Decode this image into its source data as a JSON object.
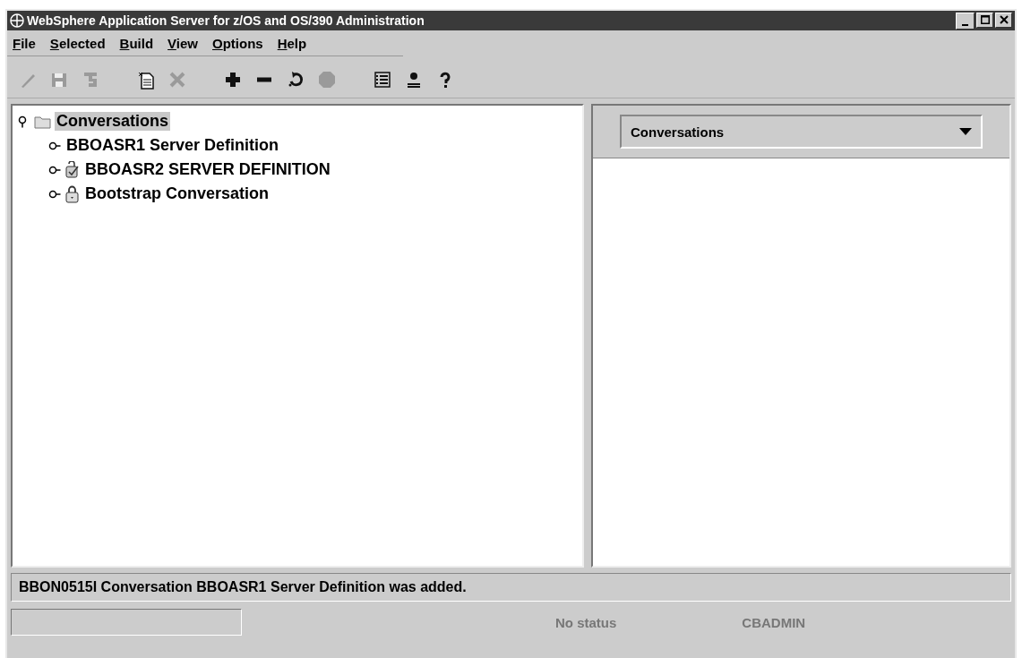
{
  "window": {
    "title": "WebSphere Application Server for z/OS and OS/390 Administration"
  },
  "menu": [
    {
      "label": "File",
      "selected": false
    },
    {
      "label": "Selected",
      "selected": false
    },
    {
      "label": "Build",
      "selected": false
    },
    {
      "label": "View",
      "selected": false
    },
    {
      "label": "Options",
      "selected": false
    },
    {
      "label": "Help",
      "selected": false
    }
  ],
  "toolbar": [
    {
      "kind": "pencil",
      "disabled": true
    },
    {
      "kind": "save",
      "disabled": true
    },
    {
      "kind": "undo",
      "disabled": true
    },
    {
      "kind": "gap"
    },
    {
      "kind": "new",
      "disabled": false
    },
    {
      "kind": "delete",
      "disabled": true
    },
    {
      "kind": "gap"
    },
    {
      "kind": "plus",
      "disabled": false
    },
    {
      "kind": "minus",
      "disabled": false
    },
    {
      "kind": "refresh",
      "disabled": false
    },
    {
      "kind": "stop",
      "disabled": true
    },
    {
      "kind": "gap"
    },
    {
      "kind": "list",
      "disabled": false
    },
    {
      "kind": "person",
      "disabled": false
    },
    {
      "kind": "help",
      "disabled": false
    }
  ],
  "tree": [
    {
      "label": "Conversations",
      "kind": "folder",
      "expanded": true,
      "selected": true,
      "children": [
        {
          "label": "BBOASR1 Server Definition",
          "kind": "plain",
          "expanded": false,
          "selected": false
        },
        {
          "label": "BBOASR2 SERVER DEFINITION",
          "kind": "check",
          "expanded": false,
          "selected": false
        },
        {
          "label": "Bootstrap Conversation",
          "kind": "lock",
          "expanded": false,
          "selected": false
        }
      ]
    }
  ],
  "view_selector": {
    "value": "Conversations"
  },
  "message": "BBON0515I Conversation BBOASR1 Server Definition was added.",
  "status_bar": {
    "status": "No status",
    "user": "CBADMIN"
  }
}
